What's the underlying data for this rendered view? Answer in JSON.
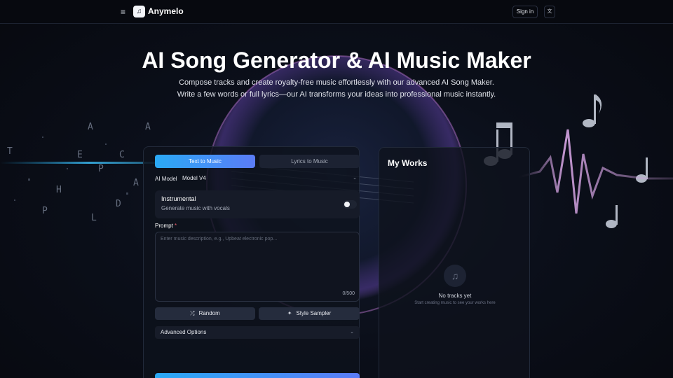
{
  "header": {
    "brand": "Anymelo",
    "sign_in": "Sign in",
    "menu_icon": "hamburger-icon",
    "logo_icon": "music-note-icon",
    "lang_icon": "translate-icon"
  },
  "hero": {
    "title": "AI Song Generator & AI Music Maker",
    "subtitle_line1": "Compose tracks and create royalty-free music effortlessly with our advanced AI Song Maker.",
    "subtitle_line2": "Write a few words or full lyrics—our AI transforms your ideas into professional music instantly."
  },
  "form": {
    "tabs": [
      {
        "label": "Text to Music",
        "active": true
      },
      {
        "label": "Lyrics to Music",
        "active": false
      }
    ],
    "model_label": "AI Model",
    "model_value": "Model V4",
    "instrumental": {
      "title": "Instrumental",
      "subtitle": "Generate music with vocals",
      "enabled": false
    },
    "prompt_label": "Prompt",
    "prompt_required_mark": "*",
    "prompt_placeholder": "Enter music description, e.g., Upbeat electronic pop...",
    "prompt_value": "",
    "char_count": "0/500",
    "random_label": "Random",
    "style_sampler_label": "Style Sampler",
    "advanced_label": "Advanced Options"
  },
  "works": {
    "title": "My Works",
    "empty_title": "No tracks yet",
    "empty_subtitle": "Start creating music to see your works here",
    "empty_icon": "music-note-icon"
  },
  "background": {
    "letters": [
      "A",
      "A",
      "T",
      "E",
      "P",
      "C",
      "A",
      "L",
      "D",
      "H",
      "P"
    ]
  },
  "colors": {
    "accent_start": "#2aa9f5",
    "accent_end": "#5b7cf6",
    "required": "#e85d6a"
  }
}
